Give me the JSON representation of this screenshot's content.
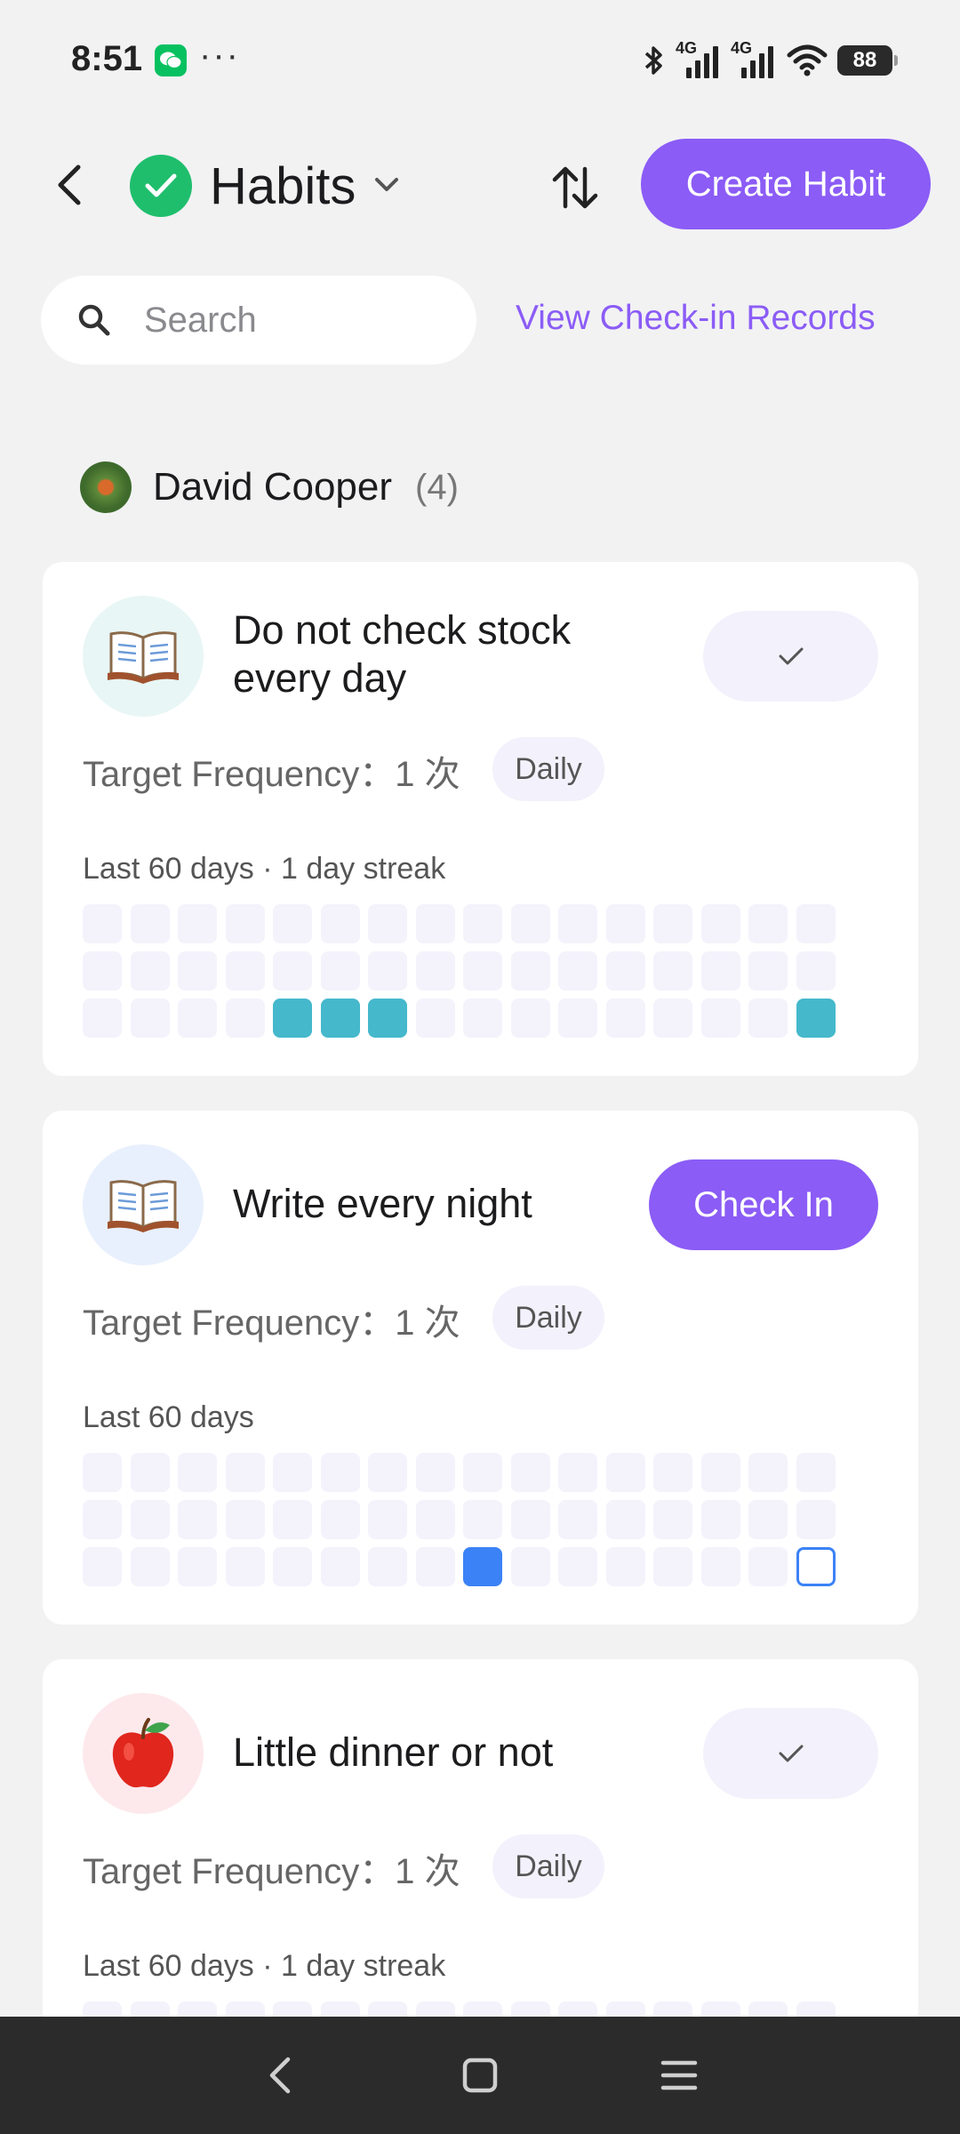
{
  "status_bar": {
    "time": "8:51",
    "dots": "···",
    "network_1": "4G",
    "network_2": "4G",
    "battery": "88"
  },
  "header": {
    "title": "Habits",
    "create_label": "Create Habit"
  },
  "search": {
    "placeholder": "Search",
    "records_link": "View Check-in Records"
  },
  "owner": {
    "name": "David Cooper",
    "count": "(4)"
  },
  "habits": [
    {
      "icon": "open-book-icon",
      "title": "Do not check stock every day",
      "action": "done",
      "frequency_label": "Target Frequency：1 次",
      "frequency_badge": "Daily",
      "streak_label": "Last 60 days · 1 day streak",
      "icon_bg": "#e8f6f5",
      "filled_cells": [
        36,
        37,
        38,
        47
      ],
      "fill_color": "#45b8cc",
      "today_cell": null
    },
    {
      "icon": "open-book-icon",
      "title": "Write every night",
      "action": "check-in",
      "action_label": "Check In",
      "frequency_label": "Target Frequency：1 次",
      "frequency_badge": "Daily",
      "streak_label": "Last 60 days",
      "icon_bg": "#e8f0fd",
      "filled_cells": [
        40
      ],
      "fill_color": "#3b82f6",
      "today_cell": 47
    },
    {
      "icon": "apple-icon",
      "title": "Little dinner or not",
      "action": "done",
      "frequency_label": "Target Frequency：1 次",
      "frequency_badge": "Daily",
      "streak_label": "Last 60 days · 1 day streak",
      "icon_bg": "#fde9ec",
      "filled_cells": [],
      "fill_color": "#45b8cc",
      "today_cell": null
    }
  ],
  "colors": {
    "accent": "#8b5cf6",
    "habit_check": "#1fbe6d",
    "background": "#f2f2f3"
  }
}
